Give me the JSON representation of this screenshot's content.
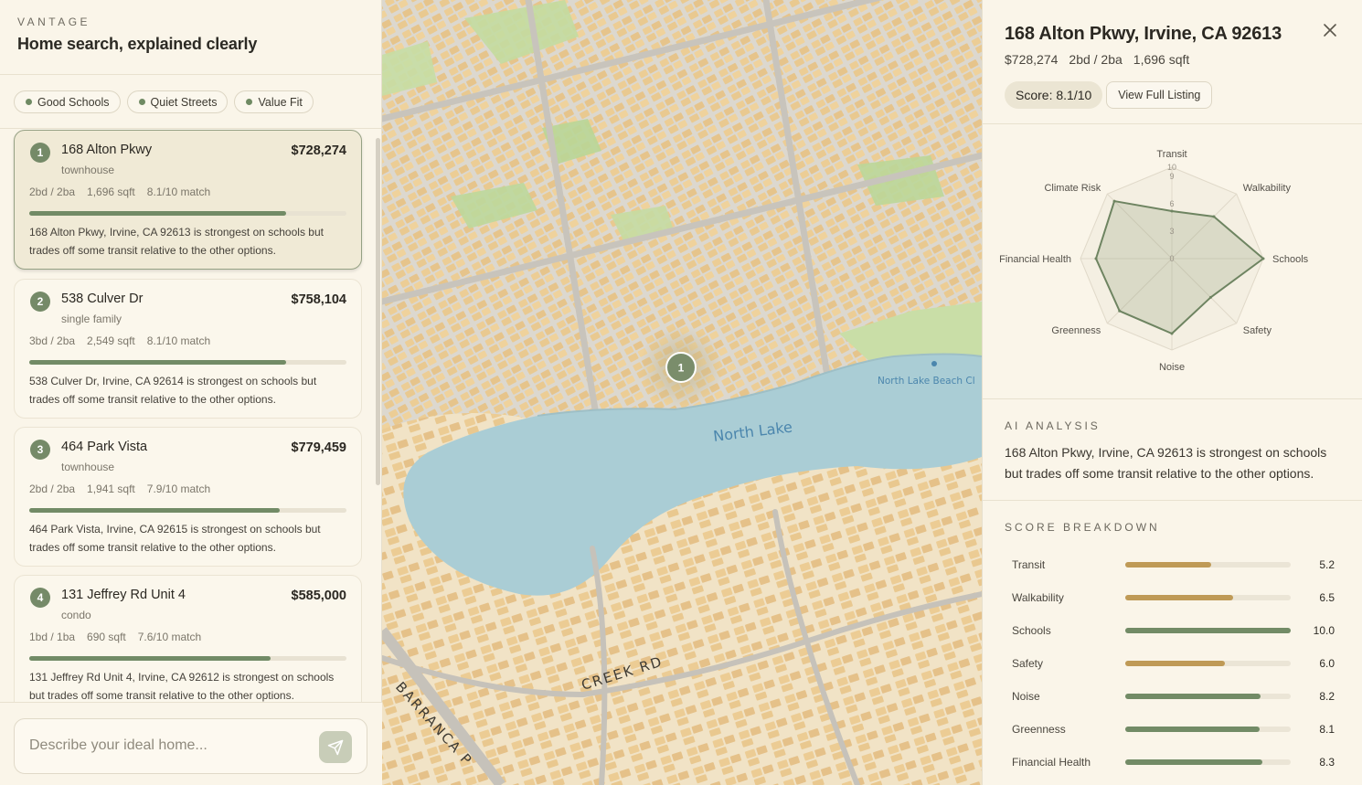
{
  "brand": {
    "name": "VANTAGE",
    "tagline": "Home search, explained clearly"
  },
  "filters": [
    {
      "label": "Good Schools"
    },
    {
      "label": "Quiet Streets"
    },
    {
      "label": "Value Fit"
    }
  ],
  "listings": [
    {
      "rank": "1",
      "name": "168 Alton Pkwy",
      "price": "$728,274",
      "type": "townhouse",
      "beds": "2bd / 2ba",
      "sqft": "1,696 sqft",
      "match": "8.1/10 match",
      "score": 0.81,
      "desc": "168 Alton Pkwy, Irvine, CA 92613 is strongest on schools but trades off some transit relative to the other options."
    },
    {
      "rank": "2",
      "name": "538 Culver Dr",
      "price": "$758,104",
      "type": "single family",
      "beds": "3bd / 2ba",
      "sqft": "2,549 sqft",
      "match": "8.1/10 match",
      "score": 0.81,
      "desc": "538 Culver Dr, Irvine, CA 92614 is strongest on schools but trades off some transit relative to the other options."
    },
    {
      "rank": "3",
      "name": "464 Park Vista",
      "price": "$779,459",
      "type": "townhouse",
      "beds": "2bd / 2ba",
      "sqft": "1,941 sqft",
      "match": "7.9/10 match",
      "score": 0.79,
      "desc": "464 Park Vista, Irvine, CA 92615 is strongest on schools but trades off some transit relative to the other options."
    },
    {
      "rank": "4",
      "name": "131 Jeffrey Rd Unit 4",
      "price": "$585,000",
      "type": "condo",
      "beds": "1bd / 1ba",
      "sqft": "690 sqft",
      "match": "7.6/10 match",
      "score": 0.76,
      "desc": "131 Jeffrey Rd Unit 4, Irvine, CA 92612 is strongest on schools but trades off some transit relative to the other options."
    }
  ],
  "search": {
    "placeholder": "Describe your ideal home..."
  },
  "map": {
    "lake_label": "North Lake",
    "road_label_1": "CREEK RD",
    "road_label_2": "BARRANCA P",
    "poi_label": "North Lake Beach Cl",
    "marker_label": "1"
  },
  "detail": {
    "title": "168 Alton Pkwy, Irvine, CA 92613",
    "price": "$728,274",
    "beds": "2bd / 2ba",
    "sqft": "1,696 sqft",
    "score": "Score: 8.1/10",
    "view_label": "View Full Listing",
    "ai_heading": "AI ANALYSIS",
    "ai_text": "168 Alton Pkwy, Irvine, CA 92613 is strongest on schools but trades off some transit relative to the other options.",
    "breakdown_heading": "SCORE BREAKDOWN"
  },
  "radar": {
    "axes": [
      "Transit",
      "Walkability",
      "Schools",
      "Safety",
      "Noise",
      "Greenness",
      "Financial Health",
      "Climate Risk"
    ],
    "values": [
      5.2,
      6.5,
      10.0,
      6.0,
      8.2,
      8.1,
      8.3,
      8.9
    ],
    "ticks": [
      "0",
      "3",
      "6",
      "9",
      "10"
    ],
    "max": 10
  },
  "breakdown": [
    {
      "label": "Transit",
      "value": "5.2",
      "score": 5.2,
      "color": "#bf9a56"
    },
    {
      "label": "Walkability",
      "value": "6.5",
      "score": 6.5,
      "color": "#bf9a56"
    },
    {
      "label": "Schools",
      "value": "10.0",
      "score": 10.0,
      "color": "#728b66"
    },
    {
      "label": "Safety",
      "value": "6.0",
      "score": 6.0,
      "color": "#bf9a56"
    },
    {
      "label": "Noise",
      "value": "8.2",
      "score": 8.2,
      "color": "#728b66"
    },
    {
      "label": "Greenness",
      "value": "8.1",
      "score": 8.1,
      "color": "#728b66"
    },
    {
      "label": "Financial Health",
      "value": "8.3",
      "score": 8.3,
      "color": "#728b66"
    }
  ],
  "colors": {
    "accent": "#728b66",
    "warn": "#bf9a56",
    "water": "#aacdd5",
    "building": "#efcf9a"
  }
}
